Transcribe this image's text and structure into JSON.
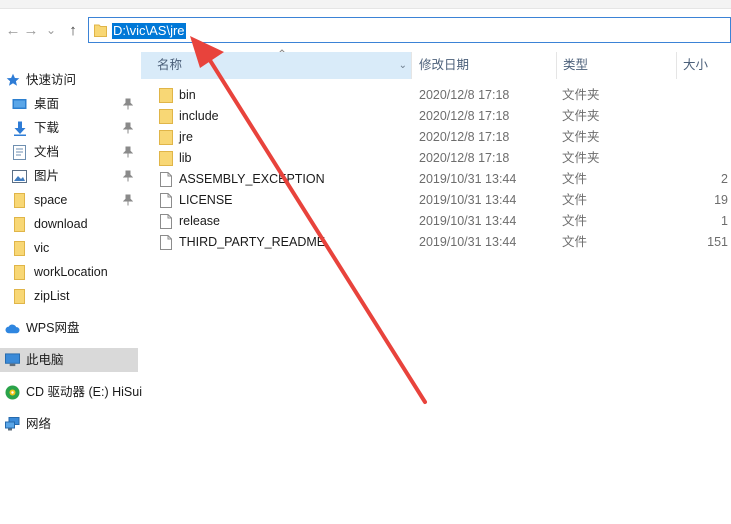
{
  "address": {
    "path": "D:\\vic\\AS\\jre"
  },
  "nav": {
    "back": "←",
    "forward": "→",
    "history": "⌄",
    "up": "↑"
  },
  "sidebar": {
    "items": [
      {
        "label": "快速访问",
        "icon": "star-icon"
      },
      {
        "label": "桌面",
        "icon": "desktop-icon",
        "pinned": true
      },
      {
        "label": "下载",
        "icon": "download-icon",
        "pinned": true
      },
      {
        "label": "文档",
        "icon": "document-icon",
        "pinned": true
      },
      {
        "label": "图片",
        "icon": "pictures-icon",
        "pinned": true
      },
      {
        "label": "space",
        "icon": "folder-icon",
        "pinned": true
      },
      {
        "label": "download",
        "icon": "folder-icon"
      },
      {
        "label": "vic",
        "icon": "folder-icon"
      },
      {
        "label": "workLocation",
        "icon": "folder-icon"
      },
      {
        "label": "zipList",
        "icon": "folder-icon"
      },
      {
        "label": "WPS网盘",
        "icon": "cloud-icon"
      },
      {
        "label": "此电脑",
        "icon": "computer-icon",
        "selected": true
      },
      {
        "label": "CD 驱动器 (E:) HiSui",
        "icon": "cd-drive-icon"
      },
      {
        "label": "网络",
        "icon": "network-icon"
      }
    ]
  },
  "columns": {
    "name": "名称",
    "modified": "修改日期",
    "type": "类型",
    "size": "大小"
  },
  "files": [
    {
      "name": "bin",
      "date": "2020/12/8 17:18",
      "type": "文件夹",
      "size": "",
      "icon": "folder-icon"
    },
    {
      "name": "include",
      "date": "2020/12/8 17:18",
      "type": "文件夹",
      "size": "",
      "icon": "folder-icon"
    },
    {
      "name": "jre",
      "date": "2020/12/8 17:18",
      "type": "文件夹",
      "size": "",
      "icon": "folder-icon"
    },
    {
      "name": "lib",
      "date": "2020/12/8 17:18",
      "type": "文件夹",
      "size": "",
      "icon": "folder-icon"
    },
    {
      "name": "ASSEMBLY_EXCEPTION",
      "date": "2019/10/31 13:44",
      "type": "文件",
      "size": "2",
      "icon": "file-icon"
    },
    {
      "name": "LICENSE",
      "date": "2019/10/31 13:44",
      "type": "文件",
      "size": "19",
      "icon": "file-icon"
    },
    {
      "name": "release",
      "date": "2019/10/31 13:44",
      "type": "文件",
      "size": "1",
      "icon": "file-icon"
    },
    {
      "name": "THIRD_PARTY_README",
      "date": "2019/10/31 13:44",
      "type": "文件",
      "size": "151",
      "icon": "file-icon"
    }
  ],
  "colors": {
    "selection": "#0078d7",
    "annotation_arrow": "#e8433c",
    "header_selected": "#d9ebf9",
    "folder": "#f8d775"
  }
}
